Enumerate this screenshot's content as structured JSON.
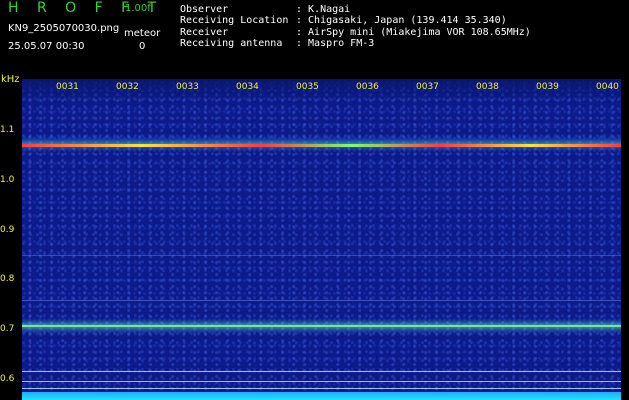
{
  "header": {
    "app_title": "H R O F F T",
    "version": "1.00f",
    "file_name": "KN9_2505070030.png",
    "meteor_label": "meteor",
    "datetime": "25.05.07 00:30",
    "meteor_count": "0"
  },
  "info": [
    {
      "key": "Observer",
      "value": ": K.Nagai"
    },
    {
      "key": "Receiving Location",
      "value": ": Chigasaki, Japan (139.414 35.340)"
    },
    {
      "key": "Receiver",
      "value": ": AirSpy mini (Miakejima VOR 108.65MHz)"
    },
    {
      "key": "Receiving antenna",
      "value": ": Maspro FM-3"
    }
  ],
  "axis": {
    "unit": "kHz",
    "y_ticks": [
      "1.1",
      "1.0",
      "0.9",
      "0.8",
      "0.7",
      "0.6"
    ],
    "x_ticks": [
      "0031",
      "0032",
      "0033",
      "0034",
      "0035",
      "0036",
      "0037",
      "0038",
      "0039",
      "0040"
    ]
  },
  "colors": {
    "background": "#000000",
    "label_green": "#2fd62f",
    "label_yellow": "#f2f23a",
    "waterfall_base": "#0c1a8a"
  }
}
